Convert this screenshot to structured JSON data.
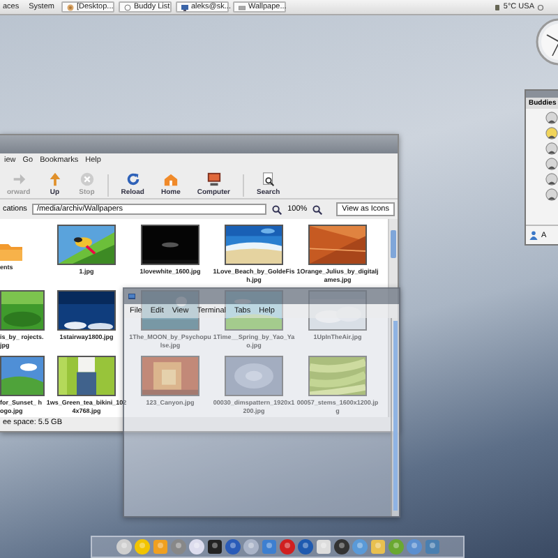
{
  "top_panel": {
    "menus": [
      "aces",
      "System"
    ],
    "tasks": [
      {
        "label": "[Desktop...",
        "kind": "globe"
      },
      {
        "label": "Buddy List",
        "kind": "ring"
      },
      {
        "label": "aleks@sk...",
        "kind": "screen"
      },
      {
        "label": "Wallpape...",
        "kind": "drive"
      }
    ],
    "weather": "5°C USA"
  },
  "file_manager": {
    "menu": [
      "iew",
      "Go",
      "Bookmarks",
      "Help"
    ],
    "toolbar": [
      {
        "label": "orward",
        "kind": "forward",
        "disabled": true
      },
      {
        "label": "Up",
        "kind": "up",
        "disabled": false
      },
      {
        "label": "Stop",
        "kind": "stop",
        "disabled": true
      },
      {
        "label": "Reload",
        "kind": "reload",
        "disabled": false
      },
      {
        "label": "Home",
        "kind": "home",
        "disabled": false
      },
      {
        "label": "Computer",
        "kind": "computer",
        "disabled": false
      },
      {
        "label": "Search",
        "kind": "search",
        "disabled": false
      }
    ],
    "location_label": "cations",
    "location": "/media/archiv/Wallpapers",
    "zoom": "100%",
    "view_mode": "View as Icons",
    "files": [
      {
        "name": "ents",
        "kind": "folder"
      },
      {
        "name": "1.jpg",
        "kind": "picture"
      },
      {
        "name": "1lovewhite_1600.jpg",
        "kind": "picture"
      },
      {
        "name": "1Love_Beach_by_GoldeFish.jpg",
        "kind": "picture"
      },
      {
        "name": "1Orange_Julius_by_digitaljames.jpg",
        "kind": "picture"
      },
      {
        "name": "is_by_ rojects.jpg",
        "kind": "picture"
      },
      {
        "name": "1stairway1800.jpg",
        "kind": "picture"
      },
      {
        "name": "1The_MOON_by_Psychopulse.jpg",
        "kind": "picture"
      },
      {
        "name": "1Time__Spring_by_Yao_Yao.jpg",
        "kind": "picture"
      },
      {
        "name": "1UpInTheAir.jpg",
        "kind": "picture"
      },
      {
        "name": "for_Sunset_ hogo.jpg",
        "kind": "picture"
      },
      {
        "name": "1ws_Green_tea_bikini_1024x768.jpg",
        "kind": "picture"
      },
      {
        "name": "123_Canyon.jpg",
        "kind": "picture"
      },
      {
        "name": "00030_dimspattern_1920x1200.jpg",
        "kind": "picture"
      },
      {
        "name": "00057_stems_1600x1200.jpg",
        "kind": "picture"
      }
    ],
    "status": "ee space: 5.5 GB"
  },
  "terminal": {
    "menu": [
      "File",
      "Edit",
      "View",
      "Terminal",
      "Tabs",
      "Help"
    ]
  },
  "buddy_list": {
    "header": "Buddies",
    "footer": "A"
  }
}
